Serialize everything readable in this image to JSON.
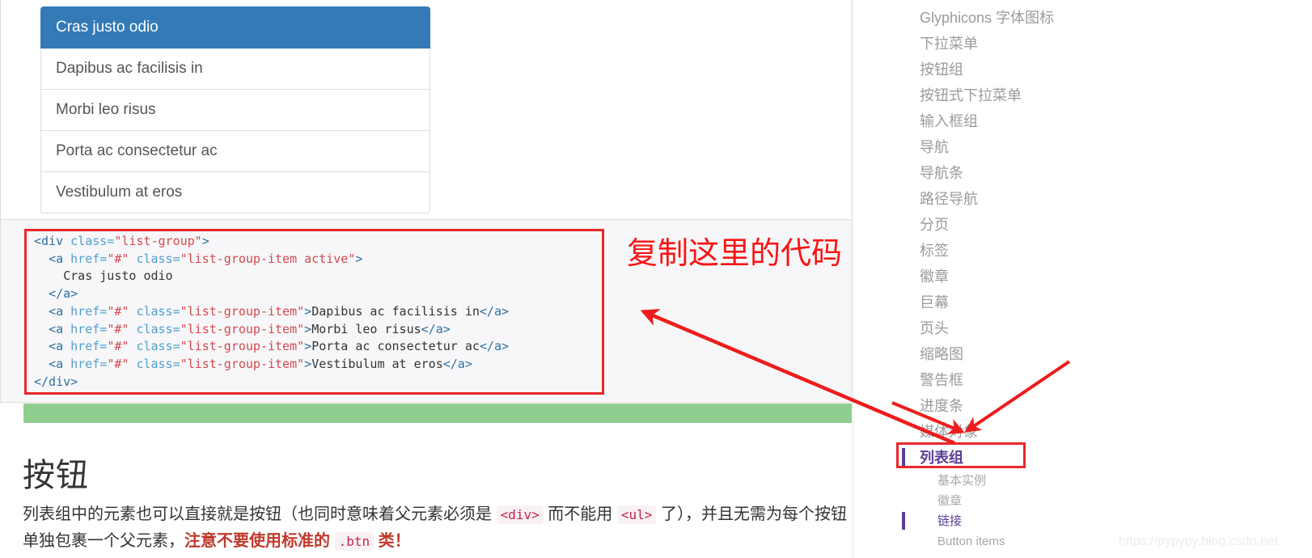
{
  "demo": {
    "list_group_items": [
      {
        "label": "Cras justo odio",
        "active": true
      },
      {
        "label": "Dapibus ac facilisis in",
        "active": false
      },
      {
        "label": "Morbi leo risus",
        "active": false
      },
      {
        "label": "Porta ac consectetur ac",
        "active": false
      },
      {
        "label": "Vestibulum at eros",
        "active": false
      }
    ]
  },
  "code_block": {
    "language": "html",
    "lines": [
      "<div class=\"list-group\">",
      "  <a href=\"#\" class=\"list-group-item active\">",
      "    Cras justo odio",
      "  </a>",
      "  <a href=\"#\" class=\"list-group-item\">Dapibus ac facilisis in</a>",
      "  <a href=\"#\" class=\"list-group-item\">Morbi leo risus</a>",
      "  <a href=\"#\" class=\"list-group-item\">Porta ac consectetur ac</a>",
      "  <a href=\"#\" class=\"list-group-item\">Vestibulum at eros</a>",
      "</div>"
    ]
  },
  "annotation": {
    "red_note": "复制这里的代码",
    "red_color": "#fa1414"
  },
  "article": {
    "heading": "按钮",
    "paragraph_part_1": "列表组中的元素也可以直接就是按钮（也同时意味着父元素必须是 ",
    "code_div": "<div>",
    "paragraph_part_2": " 而不能用 ",
    "code_ul": "<ul>",
    "paragraph_part_3": " 了），并且无需为每个按钮单独包裹一个父元素，",
    "warning": "注意不要使用标准的",
    "code_btn": ".btn",
    "warning_tail": "类！"
  },
  "toc": {
    "items": [
      {
        "label": "Glyphicons 字体图标",
        "current": false
      },
      {
        "label": "下拉菜单",
        "current": false
      },
      {
        "label": "按钮组",
        "current": false
      },
      {
        "label": "按钮式下拉菜单",
        "current": false
      },
      {
        "label": "输入框组",
        "current": false
      },
      {
        "label": "导航",
        "current": false
      },
      {
        "label": "导航条",
        "current": false
      },
      {
        "label": "路径导航",
        "current": false
      },
      {
        "label": "分页",
        "current": false
      },
      {
        "label": "标签",
        "current": false
      },
      {
        "label": "徽章",
        "current": false
      },
      {
        "label": "巨幕",
        "current": false
      },
      {
        "label": "页头",
        "current": false
      },
      {
        "label": "缩略图",
        "current": false
      },
      {
        "label": "警告框",
        "current": false
      },
      {
        "label": "进度条",
        "current": false
      },
      {
        "label": "媒体对象",
        "current": false
      },
      {
        "label": "列表组",
        "current": true
      }
    ],
    "sub_items": [
      {
        "label": "基本实例",
        "active": false
      },
      {
        "label": "徽章",
        "active": false
      },
      {
        "label": "链接",
        "active": true
      },
      {
        "label": "Button items",
        "active": false
      }
    ]
  },
  "watermark": {
    "text": "https://pypypy.blog.csdn.net"
  },
  "colors": {
    "list_active_bg": "#337ab7",
    "annotation_red": "#e8282a",
    "green_bar": "#8fce8f",
    "toc_active": "#5b3e96",
    "code_string": "#d44950",
    "code_attr": "#4f9fcf",
    "code_tag": "#2f6f9f",
    "inline_code": "#c7254e"
  }
}
